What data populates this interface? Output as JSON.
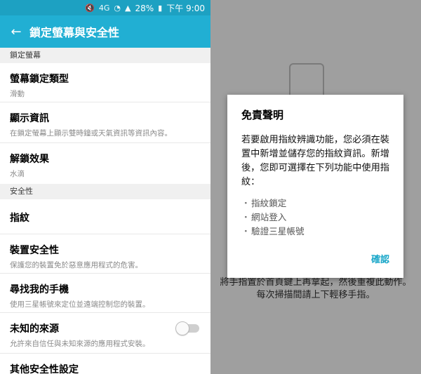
{
  "status": {
    "network": "4G",
    "battery": "28%",
    "time": "下午 9:00"
  },
  "header": {
    "title": "鎖定螢幕與安全性"
  },
  "sections": {
    "lock": "鎖定螢幕",
    "security": "安全性"
  },
  "items": {
    "lock_type": {
      "title": "螢幕鎖定類型",
      "subtitle": "滑動"
    },
    "info": {
      "title": "顯示資訊",
      "subtitle": "在鎖定螢幕上顯示雙時鐘或天氣資訊等資訊內容。"
    },
    "unlock_effect": {
      "title": "解鎖效果",
      "subtitle": "水滴"
    },
    "fingerprint": {
      "title": "指紋"
    },
    "device_security": {
      "title": "裝置安全性",
      "subtitle": "保護您的裝置免於惡意應用程式的危害。"
    },
    "find_my_phone": {
      "title": "尋找我的手機",
      "subtitle": "使用三星帳號來定位並遠端控制您的裝置。"
    },
    "unknown_sources": {
      "title": "未知的來源",
      "subtitle": "允許來自信任與未知來源的應用程式安裝。"
    },
    "other_security": {
      "title": "其他安全性設定"
    }
  },
  "dialog": {
    "title": "免責聲明",
    "body": "若要啟用指紋辨識功能，您必須在裝置中新增並儲存您的指紋資訊。新增後，您即可選擇在下列功能中使用指紋：",
    "list": [
      "指紋鎖定",
      "網站登入",
      "驗證三星帳號"
    ],
    "confirm_label": "確認"
  },
  "background_hint": "將手指置於首頁鍵上再拿起，然後重複此動作。每次掃描間請上下輕移手指。"
}
